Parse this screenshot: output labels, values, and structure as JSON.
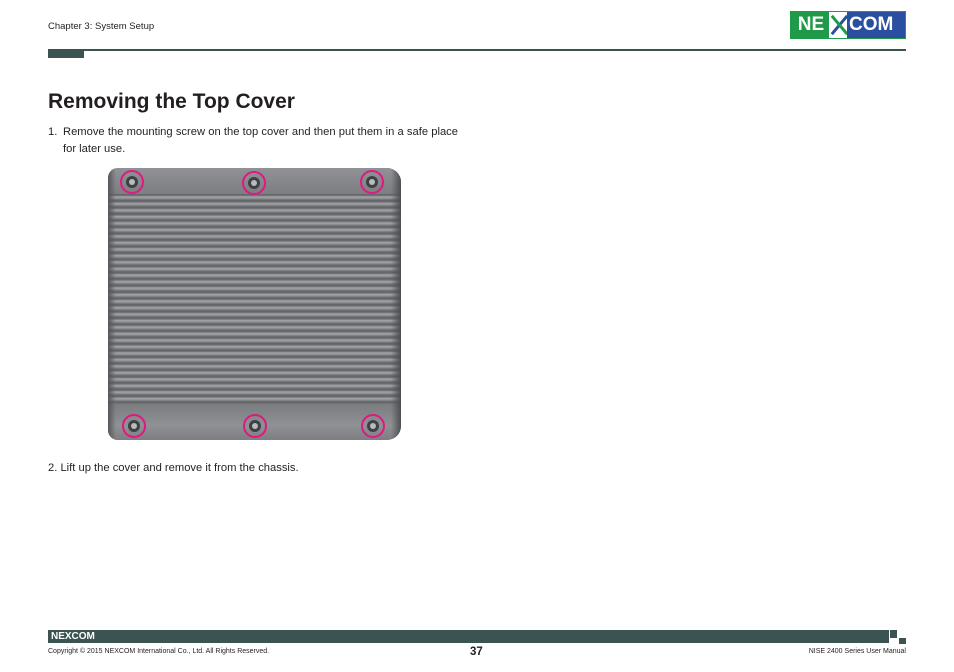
{
  "header": {
    "chapter": "Chapter 3: System Setup",
    "logo": {
      "ne": "NE",
      "com": "COM",
      "green": "#1f9a48",
      "blue": "#2b4fa0"
    },
    "rule_color": "#3b5451"
  },
  "content": {
    "title": "Removing the Top Cover",
    "steps": [
      {
        "number": "1.",
        "text": "Remove the mounting screw on the top cover and then put them in a safe place for later use."
      },
      {
        "number": "2.",
        "text": "Lift up the cover and remove it from the chassis."
      }
    ],
    "photo": {
      "subject": "top cover with fins",
      "highlight_color": "#e0187f",
      "highlighted_screws": 6
    }
  },
  "footer": {
    "logo": "NEXCOM",
    "copyright": "Copyright © 2015 NEXCOM International Co., Ltd. All Rights Reserved.",
    "page": "37",
    "manual": "NISE 2400 Series User Manual"
  }
}
